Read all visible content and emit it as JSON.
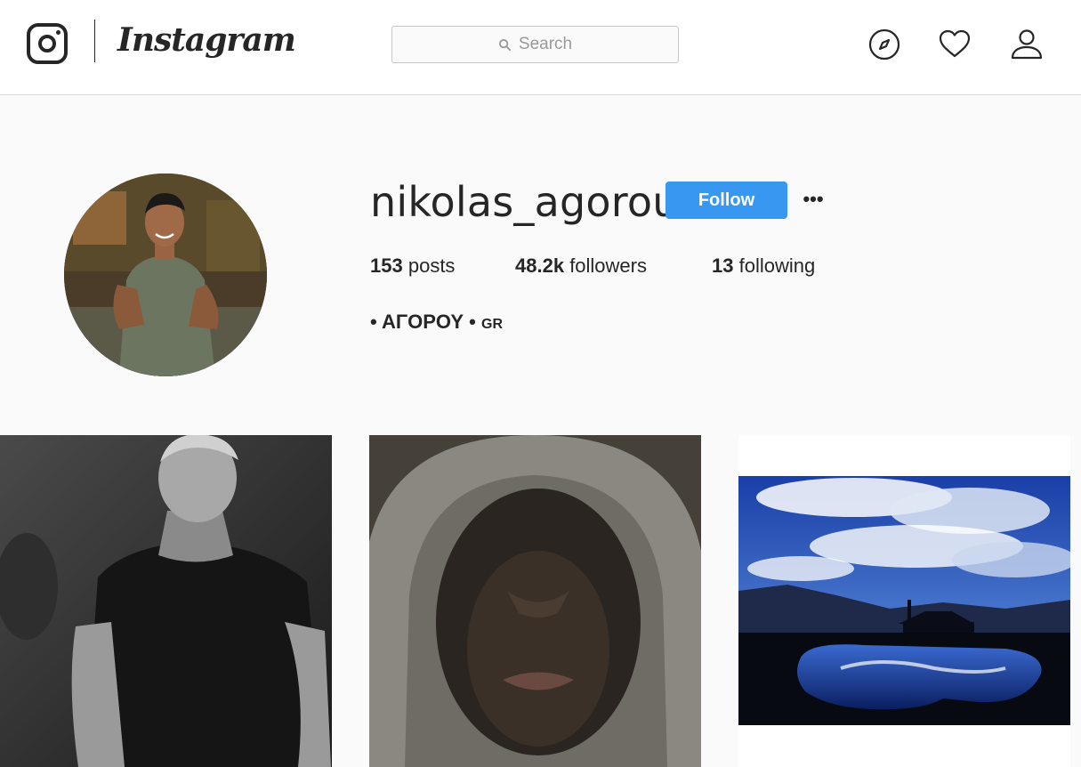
{
  "brand": {
    "wordmark": "Instagram",
    "logo_icon": "instagram-camera-icon"
  },
  "search": {
    "placeholder": "Search",
    "icon": "search-icon"
  },
  "nav": {
    "icons": [
      "compass-icon",
      "heart-icon",
      "person-icon"
    ]
  },
  "profile": {
    "username": "nikolas_agorou",
    "follow_label": "Follow",
    "more_label": "•••",
    "stats": {
      "posts_count": "153",
      "posts_label": "posts",
      "followers_count": "48.2k",
      "followers_label": "followers",
      "following_count": "13",
      "following_label": "following"
    },
    "bio_main": "• ΑΓΟΡΟΥ •",
    "bio_small": "GR"
  },
  "colors": {
    "accent": "#3897f0",
    "text": "#262626",
    "background": "#fafafa",
    "border": "#dbdbdb"
  }
}
